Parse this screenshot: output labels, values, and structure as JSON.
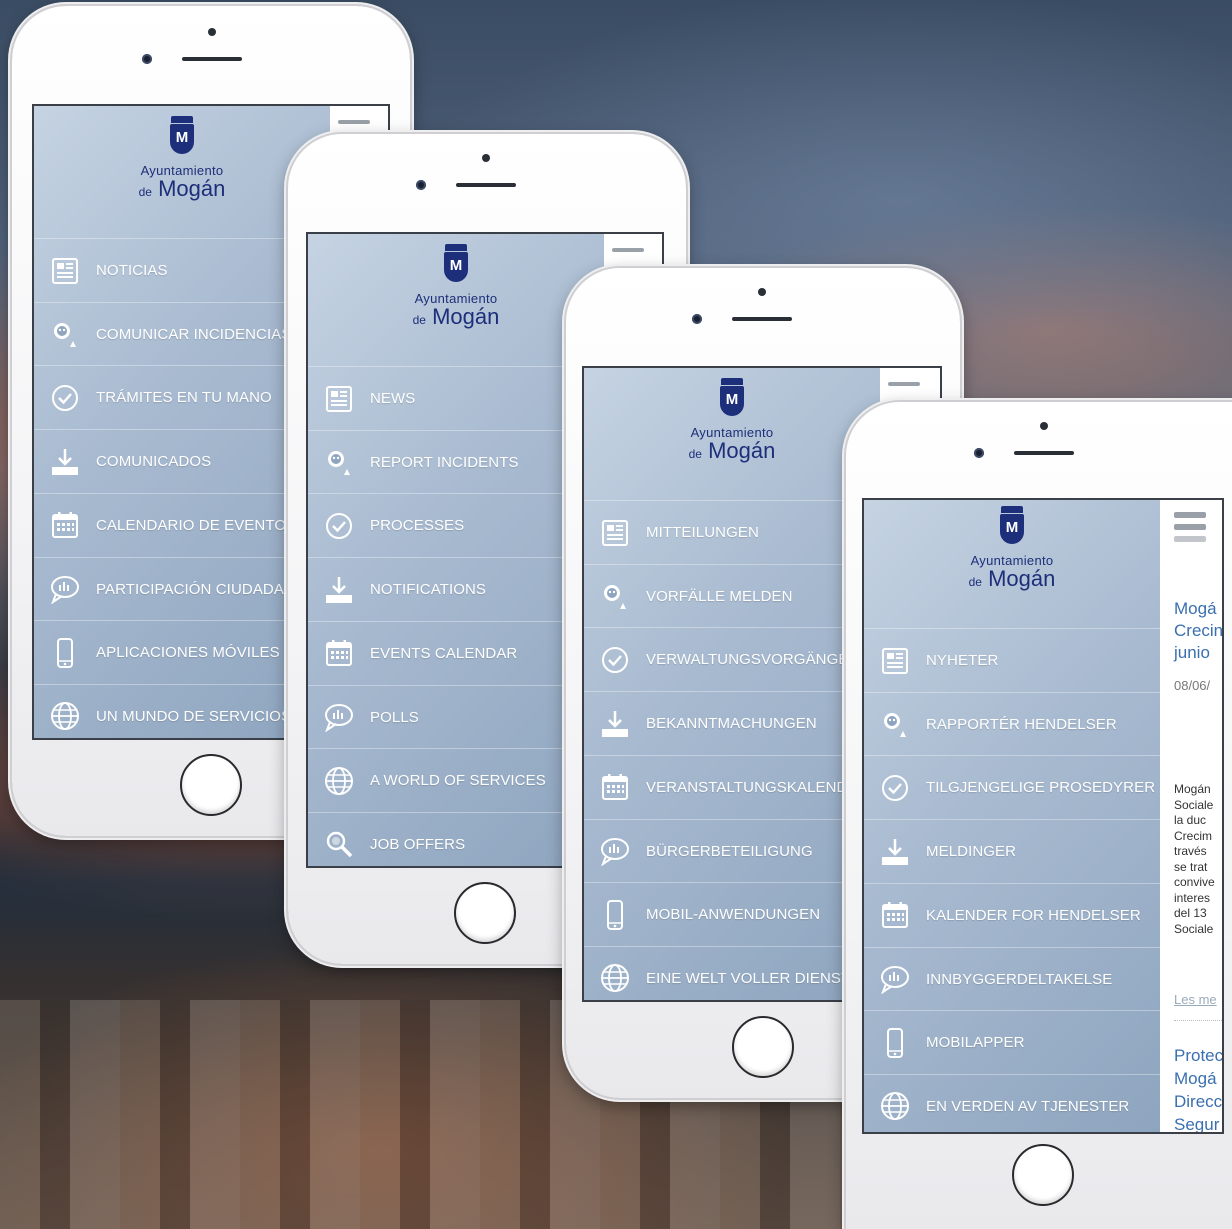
{
  "logo": {
    "line1": "Ayuntamiento",
    "line2_prefix": "de",
    "line2": "Mogán",
    "mark": "M"
  },
  "phone1": {
    "menu": [
      {
        "icon": "newspaper-icon",
        "label": "NOTICIAS"
      },
      {
        "icon": "incident-icon",
        "label": "COMUNICAR INCIDENCIAS"
      },
      {
        "icon": "check-circle-icon",
        "label": "TRÁMITES EN TU MANO"
      },
      {
        "icon": "download-tray-icon",
        "label": "COMUNICADOS"
      },
      {
        "icon": "calendar-icon",
        "label": "CALENDARIO DE EVENTOS"
      },
      {
        "icon": "speech-bubble-icon",
        "label": "PARTICIPACIÓN CIUDADANA"
      },
      {
        "icon": "mobile-phone-icon",
        "label": "APLICACIONES MÓVILES"
      },
      {
        "icon": "globe-icon",
        "label": "UN MUNDO DE SERVICIOS"
      }
    ]
  },
  "phone2": {
    "menu": [
      {
        "icon": "newspaper-icon",
        "label": "NEWS"
      },
      {
        "icon": "incident-icon",
        "label": "REPORT INCIDENTS"
      },
      {
        "icon": "check-circle-icon",
        "label": "PROCESSES"
      },
      {
        "icon": "download-tray-icon",
        "label": "NOTIFICATIONS"
      },
      {
        "icon": "calendar-icon",
        "label": "EVENTS CALENDAR"
      },
      {
        "icon": "speech-bubble-icon",
        "label": "POLLS"
      },
      {
        "icon": "globe-icon",
        "label": "A WORLD OF SERVICES"
      },
      {
        "icon": "magnifier-icon",
        "label": "JOB OFFERS"
      }
    ]
  },
  "phone3": {
    "menu": [
      {
        "icon": "newspaper-icon",
        "label": "MITTEILUNGEN"
      },
      {
        "icon": "incident-icon",
        "label": "VORFÄLLE MELDEN"
      },
      {
        "icon": "check-circle-icon",
        "label": "VERWALTUNGSVORGÄNGE A"
      },
      {
        "icon": "download-tray-icon",
        "label": "BEKANNTMACHUNGEN"
      },
      {
        "icon": "calendar-icon",
        "label": "VERANSTALTUNGSKALENDE"
      },
      {
        "icon": "speech-bubble-icon",
        "label": "BÜRGERBETEILIGUNG"
      },
      {
        "icon": "mobile-phone-icon",
        "label": "MOBIL-ANWENDUNGEN"
      },
      {
        "icon": "globe-icon",
        "label": "EINE WELT VOLLER DIENSTE"
      }
    ]
  },
  "phone4": {
    "menu": [
      {
        "icon": "newspaper-icon",
        "label": "NYHETER"
      },
      {
        "icon": "incident-icon",
        "label": "RAPPORTÉR HENDELSER"
      },
      {
        "icon": "check-circle-icon",
        "label": "TILGJENGELIGE PROSEDYRER"
      },
      {
        "icon": "download-tray-icon",
        "label": "MELDINGER"
      },
      {
        "icon": "calendar-icon",
        "label": "KALENDER FOR HENDELSER"
      },
      {
        "icon": "speech-bubble-icon",
        "label": "INNBYGGERDELTAKELSE"
      },
      {
        "icon": "mobile-phone-icon",
        "label": "MOBILAPPER"
      },
      {
        "icon": "globe-icon",
        "label": "EN VERDEN AV TJENESTER"
      }
    ],
    "news": {
      "title_lines": [
        "Mogá",
        "Crecin",
        "junio"
      ],
      "date": "08/06/",
      "body_lines": [
        "Mogán",
        "Sociale",
        "la duc",
        "Crecim",
        "través",
        "se trat",
        "convive",
        "interes",
        "del 13",
        "Sociale"
      ],
      "read_more": "Les me",
      "title2_lines": [
        "Protec",
        "Mogá",
        "Direcc",
        "Segur"
      ]
    }
  },
  "colors": {
    "brand": "#1d2f7a",
    "menu_text": "#ffffff",
    "news_title": "#3a6fb0"
  }
}
